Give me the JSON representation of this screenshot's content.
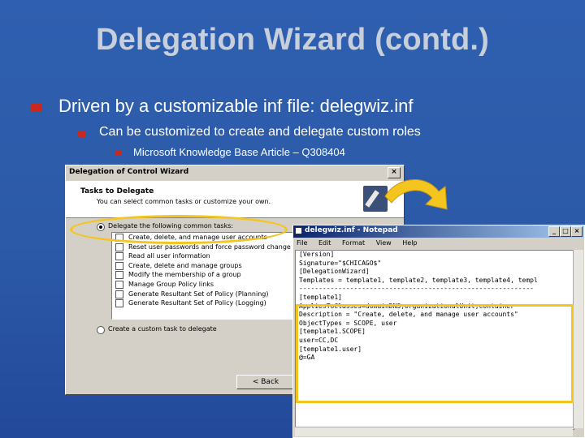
{
  "slide": {
    "title": "Delegation Wizard (contd.)",
    "bullets": [
      "Driven by a customizable inf file: delegwiz.inf",
      "Can be customized to create and delegate custom roles",
      "Microsoft Knowledge Base Article – Q308404"
    ]
  },
  "wizard": {
    "title": "Delegation of Control Wizard",
    "close_glyph": "×",
    "header_title": "Tasks to Delegate",
    "header_subtitle": "You can select common tasks or customize your own.",
    "option_common": "Delegate the following common tasks:",
    "tasks": [
      "Create, delete, and manage user accounts",
      "Reset user passwords and force password change",
      "Read all user information",
      "Create, delete and manage groups",
      "Modify the membership of a group",
      "Manage Group Policy links",
      "Generate Resultant Set of Policy (Planning)",
      "Generate Resultant Set of Policy (Logging)"
    ],
    "option_custom": "Create a custom task to delegate",
    "back_button": "< Back"
  },
  "notepad": {
    "title": "delegwiz.inf - Notepad",
    "menu": [
      "File",
      "Edit",
      "Format",
      "View",
      "Help"
    ],
    "lines": [
      "[Version]",
      "Signature=\"$CHICAGO$\"",
      "",
      "[DelegationWizard]",
      "",
      "Templates = template1, template2, template3, template4, templ",
      "",
      "------------------------------------------------------------",
      "[template1]",
      "AppliesToClasses=domainDNS,organizationalUnit,container",
      "",
      "Description = \"Create, delete, and manage user accounts\"",
      "ObjectTypes = SCOPE, user",
      "",
      "[template1.SCOPE]",
      "user=CC,DC",
      "",
      "[template1.user]",
      "@=GA"
    ]
  },
  "colors": {
    "background": "#2c5aa8",
    "title": "#c7cfdb",
    "bullet": "#c8281e",
    "highlight": "#f5c51f"
  }
}
